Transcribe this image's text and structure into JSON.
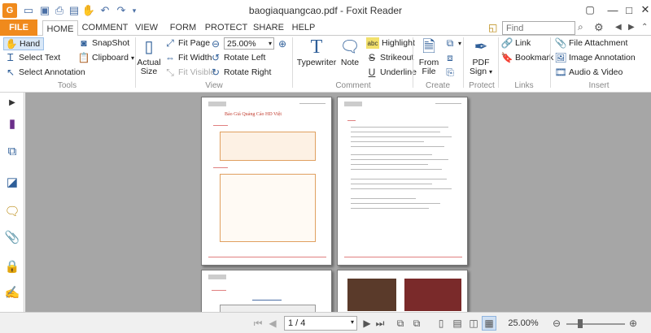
{
  "window": {
    "title": "baogiaquangcao.pdf - Foxit Reader"
  },
  "tabs": {
    "file": "FILE",
    "items": [
      "HOME",
      "COMMENT",
      "VIEW",
      "FORM",
      "PROTECT",
      "SHARE",
      "HELP"
    ]
  },
  "search": {
    "placeholder": "Find"
  },
  "ribbon": {
    "tools": {
      "hand": "Hand",
      "select_text": "Select Text",
      "select_annotation": "Select Annotation",
      "snapshot": "SnapShot",
      "clipboard": "Clipboard",
      "group": "Tools"
    },
    "view": {
      "actual_size_1": "Actual",
      "actual_size_2": "Size",
      "fit_page": "Fit Page",
      "fit_width": "Fit Width",
      "fit_visible": "Fit Visible",
      "zoom": "25.00%",
      "rotate_left": "Rotate Left",
      "rotate_right": "Rotate Right",
      "group": "View"
    },
    "comment": {
      "typewriter": "Typewriter",
      "note": "Note",
      "highlight": "Highlight",
      "strikeout": "Strikeout",
      "underline": "Underline",
      "group": "Comment"
    },
    "create": {
      "from_file_1": "From",
      "from_file_2": "File",
      "group": "Create"
    },
    "protect": {
      "pdf_sign_1": "PDF",
      "pdf_sign_2": "Sign",
      "group": "Protect"
    },
    "links": {
      "link": "Link",
      "bookmark": "Bookmark",
      "group": "Links"
    },
    "insert": {
      "file_attachment": "File Attachment",
      "image_annotation": "Image Annotation",
      "audio_video": "Audio & Video",
      "group": "Insert"
    }
  },
  "document": {
    "page1_title": "Bảo Giá Quảng Cáo HD Việt"
  },
  "status": {
    "page": "1 / 4",
    "zoom": "25.00%"
  },
  "colors": {
    "file_tab": "#f08a1c",
    "accent": "#2f5f99",
    "doc_bg": "#a6a6a6"
  }
}
